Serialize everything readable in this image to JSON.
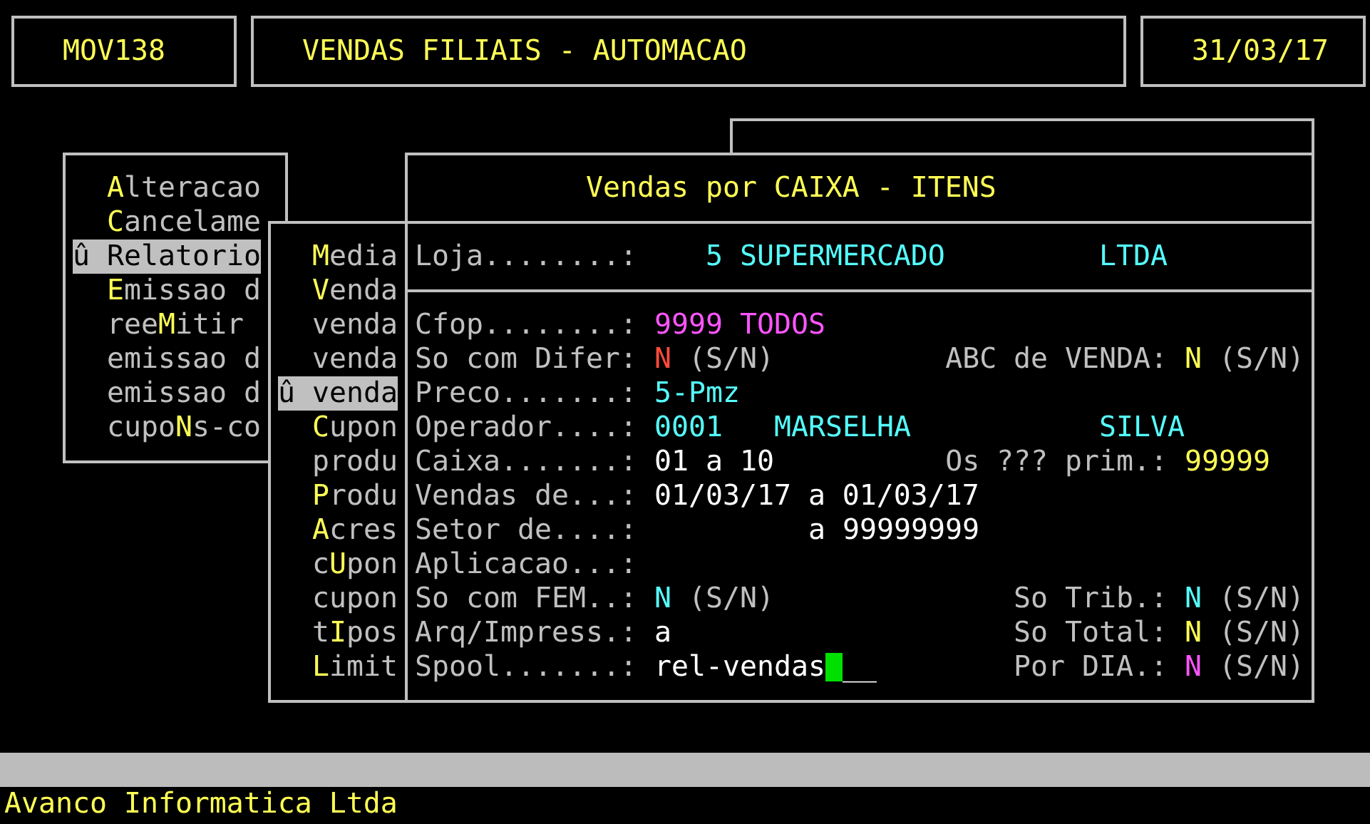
{
  "header": {
    "program_code": "MOV138",
    "title": "VENDAS FILIAIS - AUTOMACAO",
    "date": "31/03/17"
  },
  "menu": {
    "items": [
      {
        "key": "A",
        "post": "lteracao",
        "selected": false
      },
      {
        "key": "C",
        "post": "ancelame",
        "selected": false
      },
      {
        "marker": "û",
        "pre": "Relatorio",
        "selected": true
      },
      {
        "key": "E",
        "post": "missao d",
        "selected": false
      },
      {
        "pre": "ree",
        "key": "M",
        "post": "itir",
        "selected": false
      },
      {
        "pre": "emissao d",
        "selected": false
      },
      {
        "pre": "emissao d",
        "selected": false
      },
      {
        "pre": "cupo",
        "key": "N",
        "post": "s-co",
        "selected": false
      }
    ]
  },
  "submenu": {
    "items": [
      {
        "key": "M",
        "post": "edia",
        "selected": false
      },
      {
        "key": "V",
        "post": "enda",
        "selected": false
      },
      {
        "pre": "venda",
        "selected": false
      },
      {
        "pre": "venda",
        "selected": false
      },
      {
        "marker": "û",
        "pre": "venda",
        "selected": true
      },
      {
        "key": "C",
        "post": "upon",
        "selected": false
      },
      {
        "pre": "produ",
        "selected": false
      },
      {
        "key": "P",
        "post": "rodu",
        "selected": false
      },
      {
        "key": "A",
        "post": "cres",
        "selected": false
      },
      {
        "pre": "c",
        "key": "U",
        "post": "pon",
        "selected": false
      },
      {
        "pre": "cupon",
        "selected": false
      },
      {
        "pre": "t",
        "key": "I",
        "post": "pos",
        "selected": false
      },
      {
        "key": "L",
        "post": "imit",
        "selected": false
      }
    ]
  },
  "dialog": {
    "title": "Vendas por CAIXA - ITENS",
    "store": {
      "label": "Loja........:",
      "values": [
        {
          "text": "5 SUPERMERCADO",
          "color": "#55ffff"
        },
        {
          "text": "LTDA",
          "color": "#55ffff"
        }
      ]
    },
    "rows": [
      {
        "label": "Cfop........:",
        "values": [
          {
            "text": "9999 TODOS",
            "color": "#ff55ff"
          }
        ]
      },
      {
        "label": "So com Difer:",
        "values": [
          {
            "text": "N",
            "color": "#ff4b3a"
          },
          {
            "text": "(S/N)",
            "color": "#c0c0c0"
          }
        ],
        "side": {
          "label": "ABC de VENDA:",
          "values": [
            {
              "text": "N",
              "color": "#ffff55"
            },
            {
              "text": "(S/N)",
              "color": "#c0c0c0"
            }
          ]
        }
      },
      {
        "label": "Preco.......:",
        "values": [
          {
            "text": "5-Pmz",
            "color": "#55ffff"
          }
        ]
      },
      {
        "label": "Operador....:",
        "values": [
          {
            "text": "0001",
            "color": "#55ffff"
          },
          {
            "text": "MARSELHA",
            "color": "#55ffff"
          },
          {
            "text": "SILVA",
            "color": "#55ffff"
          }
        ]
      },
      {
        "label": "Caixa.......:",
        "values": [
          {
            "text": "01 a 10",
            "color": "#ffffff"
          }
        ],
        "side": {
          "label": "Os ??? prim.:",
          "values": [
            {
              "text": "99999",
              "color": "#ffff55"
            }
          ]
        }
      },
      {
        "label": "Vendas de...:",
        "values": [
          {
            "text": "01/03/17 a 01/03/17",
            "color": "#ffffff"
          }
        ]
      },
      {
        "label": "Setor de....:",
        "values": [
          {
            "text": "a 99999999",
            "color": "#ffffff"
          }
        ]
      },
      {
        "label": "Aplicacao...:",
        "values": []
      },
      {
        "label": "So com FEM..:",
        "values": [
          {
            "text": "N",
            "color": "#55ffff"
          },
          {
            "text": "(S/N)",
            "color": "#c0c0c0"
          }
        ],
        "side": {
          "label": "So Trib.:",
          "values": [
            {
              "text": "N",
              "color": "#55ffff"
            },
            {
              "text": "(S/N)",
              "color": "#c0c0c0"
            }
          ]
        }
      },
      {
        "label": "Arq/Impress.:",
        "values": [
          {
            "text": "a",
            "color": "#ffffff"
          }
        ],
        "side": {
          "label": "So Total:",
          "values": [
            {
              "text": "N",
              "color": "#ffff55"
            },
            {
              "text": "(S/N)",
              "color": "#c0c0c0"
            }
          ]
        }
      },
      {
        "label": "Spool.......:",
        "values": [
          {
            "text": "rel-vendas",
            "color": "#ffffff",
            "cursor": true
          },
          {
            "text": "__",
            "color": "#ffffff"
          }
        ],
        "side": {
          "label": "Por DIA.:",
          "values": [
            {
              "text": "N",
              "color": "#ff55ff"
            },
            {
              "text": "(S/N)",
              "color": "#c0c0c0"
            }
          ]
        }
      }
    ]
  },
  "status_bar": {
    "text": "Avanco Informatica Ltda"
  }
}
